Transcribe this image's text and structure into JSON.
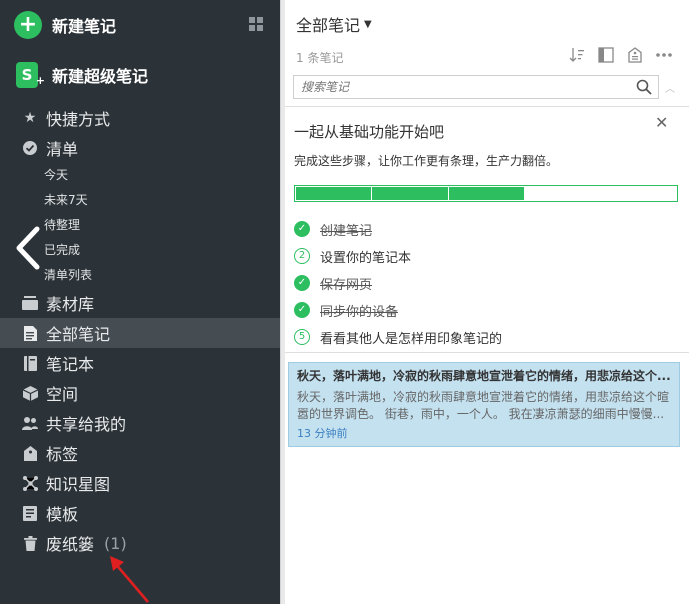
{
  "sidebar": {
    "new_note": "新建笔记",
    "new_super_note": "新建超级笔记",
    "shortcuts": "快捷方式",
    "checklist": "清单",
    "sub": [
      "今天",
      "未来7天",
      "待整理",
      "已完成",
      "清单列表"
    ],
    "library": "素材库",
    "all_notes": "全部笔记",
    "notebooks": "笔记本",
    "spaces": "空间",
    "shared": "共享给我的",
    "tags": "标签",
    "mindmap": "知识星图",
    "templates": "模板",
    "trash": "废纸篓",
    "trash_count": "(1)"
  },
  "list": {
    "title": "全部笔记",
    "count": "1 条笔记",
    "search_placeholder": "搜索笔记"
  },
  "onboarding": {
    "title": "一起从基础功能开始吧",
    "subtitle": "完成这些步骤，让你工作更有条理，生产力翻倍。",
    "progress": 0.6,
    "steps": [
      {
        "label": "创建笔记",
        "done": true
      },
      {
        "label": "设置你的笔记本",
        "done": false,
        "num": "2"
      },
      {
        "label": "保存网页",
        "done": true
      },
      {
        "label": "同步你的设备",
        "done": true
      },
      {
        "label": "看看其他人是怎样用印象笔记的",
        "done": false,
        "num": "5"
      }
    ]
  },
  "note": {
    "title": "秋天，落叶满地，冷寂的秋雨肆意地宣泄着它的情绪，用悲凉给这个...",
    "snippet": "秋天，落叶满地，冷寂的秋雨肆意地宣泄着它的情绪，用悲凉给这个暄嚣的世界调色。 街巷，雨中，一个人。 我在凄凉萧瑟的细雨中慢慢...",
    "time": "13 分钟前"
  },
  "colors": {
    "accent": "#2dbe60",
    "sidebar_bg": "#2c3338",
    "selected_note_bg": "#c4e1f0",
    "annotation_arrow": "#e02020"
  }
}
